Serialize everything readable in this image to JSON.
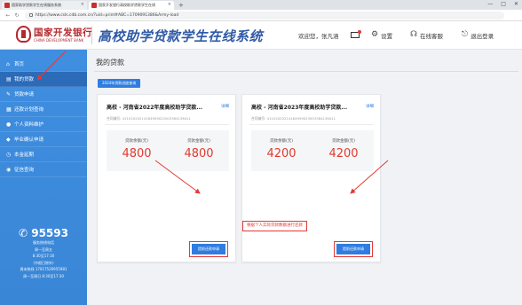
{
  "browser": {
    "tabs": [
      {
        "label": "国家助学贷款学生在线服务系统",
        "active": false
      },
      {
        "label": "国家开发银行高校助学贷款学生在线",
        "active": true
      }
    ],
    "new_tab": "+",
    "window_controls": [
      "—",
      "□",
      "✕"
    ],
    "url": "https://www.csls.cdb.com.cn/?uid=print#ABC=1709091386&Army-load"
  },
  "header": {
    "bank_name_cn": "国家开发银行",
    "bank_name_en": "CHINA DEVELOPMENT BANK",
    "system_title": "高校助学贷款学生在线系统",
    "welcome": "欢迎您，张凡涵",
    "settings": "设置",
    "online_help": "在线客服",
    "logout": "退出登录"
  },
  "sidebar": {
    "items": [
      {
        "label": "首页",
        "icon": "home-icon",
        "glyph": "⌂",
        "active": false
      },
      {
        "label": "我的贷款",
        "icon": "loan-icon",
        "glyph": "▤",
        "active": true
      },
      {
        "label": "贷款申请",
        "icon": "apply-icon",
        "glyph": "✎",
        "active": false
      },
      {
        "label": "还款计划查询",
        "icon": "plan-icon",
        "glyph": "▦",
        "active": false
      },
      {
        "label": "个人资料维护",
        "icon": "user-icon",
        "glyph": "●",
        "active": false
      },
      {
        "label": "毕业确认申请",
        "icon": "grad-icon",
        "glyph": "◆",
        "active": false
      },
      {
        "label": "本金延期",
        "icon": "defer-icon",
        "glyph": "◷",
        "active": false
      },
      {
        "label": "征信查询",
        "icon": "credit-icon",
        "glyph": "◉",
        "active": false
      }
    ],
    "hotline": {
      "number": "95593",
      "lines": [
        "服务热线电话",
        "周一至周五",
        "8:30至17:30",
        "(节假日除外)",
        "周末热线 17017526955981",
        "周一至周日 8:30至17:30"
      ]
    }
  },
  "main": {
    "title": "我的贷款",
    "records_button": "2024年贷款进度查询",
    "cards": [
      {
        "title": "高校 - 河南省2022年度高校助学贷款...",
        "link": "详细",
        "contract": "合同编号: 41102020214184959022003384136411",
        "balance_label": "贷款余额(元)",
        "balance": "4800",
        "amount_label": "贷款金额(元)",
        "amount": "4800",
        "button": "提前还款申请"
      },
      {
        "title": "高校 - 河南省2023年度高校助学贷款...",
        "link": "详细",
        "contract": "合同编号: 41102020214184959023003384136411",
        "balance_label": "贷款余额(元)",
        "balance": "4200",
        "amount_label": "贷款金额(元)",
        "amount": "4200",
        "button": "提前还款申请"
      }
    ],
    "note": "根据个人实际贷款数额进行还款"
  },
  "colors": {
    "sidebar": "#3a86d6",
    "sidebar_active": "#2b6bb8",
    "accent_blue": "#2f7de1",
    "amount_red": "#e23a2f",
    "annotation_red": "#e53935",
    "brand_red": "#b5282e"
  }
}
